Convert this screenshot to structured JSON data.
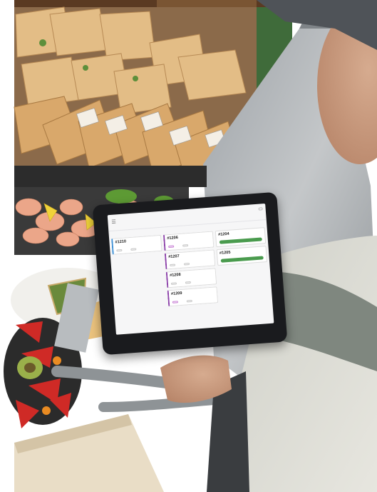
{
  "scene": {
    "description_free": true,
    "palette": {
      "background": "#ffffff",
      "counter_steel": "#a8acaf",
      "bread": "#d9a86b",
      "salad_red": "#c0282b",
      "shrimp": "#e9a488",
      "sleeve": "#8a928a",
      "tablet_bezel": "#1a1b1e",
      "screen_bg": "#f6f6f7",
      "accent_purple": "#8a3ea8",
      "accent_blue": "#3b8fd6",
      "button_green": "#4a9b4e"
    }
  },
  "tablet": {
    "title": "",
    "subtitle": "",
    "action_label": "",
    "columns": [
      {
        "header": "",
        "cards": [
          {
            "number": "#1210",
            "meta": "",
            "chip": "",
            "chip2": "",
            "accent": "blue"
          }
        ]
      },
      {
        "header": "",
        "cards": [
          {
            "number": "#1206",
            "meta": "",
            "chip": "",
            "chip2": "",
            "accent": "purple"
          },
          {
            "number": "#1207",
            "meta": "",
            "chip": "",
            "chip2": "",
            "accent": "purple"
          },
          {
            "number": "#1208",
            "meta": "",
            "chip": "",
            "chip2": "",
            "accent": "purple"
          },
          {
            "number": "#1209",
            "meta": "",
            "chip": "",
            "chip2": "",
            "accent": "purple"
          }
        ]
      },
      {
        "header": "",
        "cards": [
          {
            "number": "#1204",
            "meta": "",
            "button": ""
          },
          {
            "number": "#1205",
            "meta": "",
            "button": ""
          }
        ]
      }
    ]
  }
}
